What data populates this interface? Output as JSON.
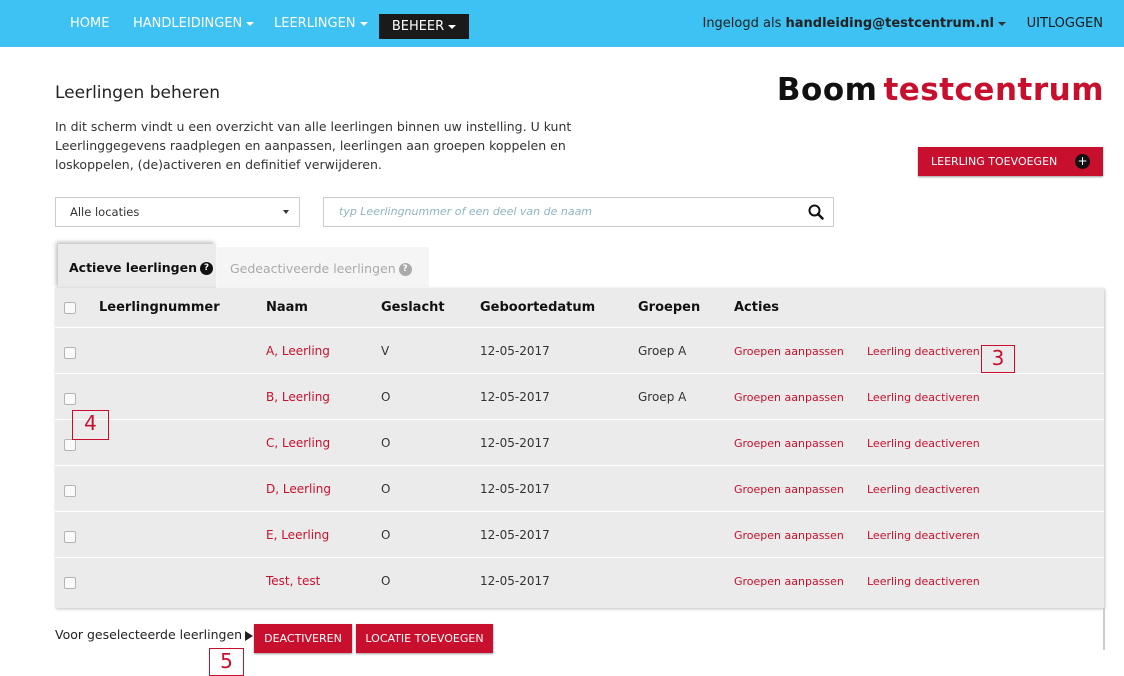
{
  "nav": {
    "home": "HOME",
    "handleidingen": "HANDLEIDINGEN",
    "leerlingen": "LEERLINGEN",
    "beheer": "BEHEER",
    "logged_in_prefix": "Ingelogd als",
    "user_email": "handleiding@testcentrum.nl",
    "logout": "UITLOGGEN"
  },
  "colors": {
    "nav_bg": "#3dc2f3",
    "accent": "#c8102e",
    "table_bg": "#ebebeb"
  },
  "page": {
    "title": "Leerlingen beheren",
    "intro": "In dit scherm vindt u een overzicht van alle leerlingen binnen uw instelling. U kunt Leerlinggegevens raadplegen en aanpassen, leerlingen aan groepen koppelen en loskoppelen, (de)activeren en definitief verwijderen.",
    "logo_part1": "Boom",
    "logo_part2": "testcentrum",
    "add_button": "LEERLING TOEVOEGEN",
    "add_icon": "plus-icon"
  },
  "filters": {
    "location_selected": "Alle locaties",
    "search_placeholder": "typ Leerlingnummer of een deel van de naam",
    "search_icon": "magnifier-icon"
  },
  "tabs": {
    "active": "Actieve leerlingen",
    "inactive": "Gedeactiveerde leerlingen"
  },
  "table": {
    "headers": [
      "Leerlingnummer",
      "Naam",
      "Geslacht",
      "Geboortedatum",
      "Groepen",
      "Acties"
    ],
    "rows": [
      {
        "number": "",
        "name": "A, Leerling",
        "gender": "V",
        "dob": "12-05-2017",
        "group": "Groep A",
        "action1": "Groepen aanpassen",
        "action2": "Leerling deactiveren"
      },
      {
        "number": "",
        "name": "B, Leerling",
        "gender": "O",
        "dob": "12-05-2017",
        "group": "Groep A",
        "action1": "Groepen aanpassen",
        "action2": "Leerling deactiveren"
      },
      {
        "number": "",
        "name": "C, Leerling",
        "gender": "O",
        "dob": "12-05-2017",
        "group": "",
        "action1": "Groepen aanpassen",
        "action2": "Leerling deactiveren"
      },
      {
        "number": "",
        "name": "D, Leerling",
        "gender": "O",
        "dob": "12-05-2017",
        "group": "",
        "action1": "Groepen aanpassen",
        "action2": "Leerling deactiveren"
      },
      {
        "number": "",
        "name": "E, Leerling",
        "gender": "O",
        "dob": "12-05-2017",
        "group": "",
        "action1": "Groepen aanpassen",
        "action2": "Leerling deactiveren"
      },
      {
        "number": "",
        "name": "Test, test",
        "gender": "O",
        "dob": "12-05-2017",
        "group": "",
        "action1": "Groepen aanpassen",
        "action2": "Leerling deactiveren"
      }
    ]
  },
  "footer": {
    "selected_label": "Voor geselecteerde leerlingen",
    "deactivate_button": "DEACTIVEREN",
    "add_location_button": "LOCATIE TOEVOEGEN"
  },
  "annotations": [
    "3",
    "4",
    "5"
  ]
}
